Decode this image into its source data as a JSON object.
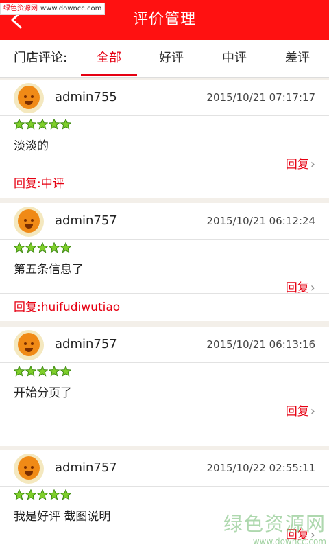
{
  "watermark_top": {
    "site": "绿色资源网",
    "url": "www.downcc.com"
  },
  "header": {
    "title": "评价管理"
  },
  "filter": {
    "label": "门店评论:",
    "tabs": [
      {
        "label": "全部",
        "active": true
      },
      {
        "label": "好评",
        "active": false
      },
      {
        "label": "中评",
        "active": false
      },
      {
        "label": "差评",
        "active": false
      }
    ]
  },
  "reviews": [
    {
      "user": "admin755",
      "time": "2015/10/21 07:17:17",
      "rating": 5,
      "content": "淡淡的",
      "reply_button": "回复",
      "reply": "回复:中评"
    },
    {
      "user": "admin757",
      "time": "2015/10/21 06:12:24",
      "rating": 5,
      "content": "第五条信息了",
      "reply_button": "回复",
      "reply": "回复:huifudiwutiao"
    },
    {
      "user": "admin757",
      "time": "2015/10/21 06:13:16",
      "rating": 5,
      "content": "开始分页了",
      "reply_button": "回复",
      "reply": ""
    },
    {
      "user": "admin757",
      "time": "2015/10/22 02:55:11",
      "rating": 5,
      "content": "我是好评 截图说明",
      "reply_button": "回复",
      "reply": ""
    }
  ],
  "watermark_bottom": {
    "site": "绿色资源网",
    "url": "www.downcc.com"
  },
  "colors": {
    "header": "#ff1111",
    "accent": "#e60012",
    "star": "#7fcf2b"
  }
}
